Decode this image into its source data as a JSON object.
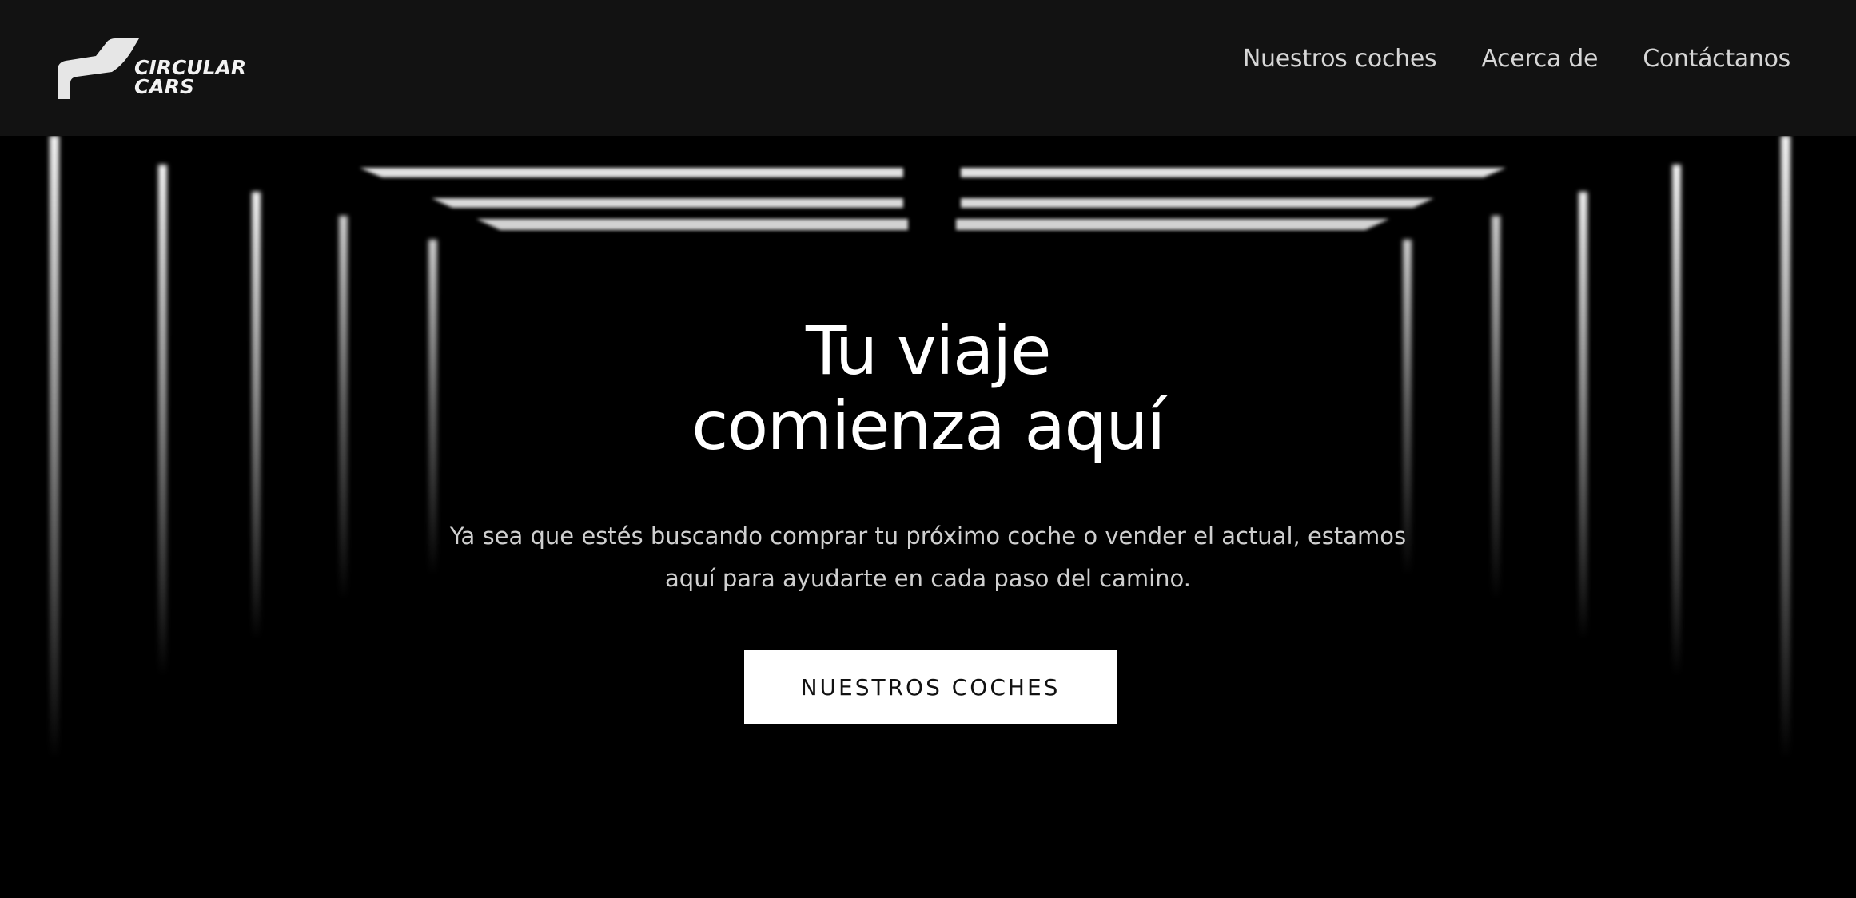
{
  "brand": {
    "line1": "CIRCULAR",
    "line2": "CARS",
    "logo_icon": "car-seat-logo-icon"
  },
  "nav": {
    "items": [
      {
        "label": "Nuestros coches"
      },
      {
        "label": "Acerca de"
      },
      {
        "label": "Contáctanos"
      }
    ]
  },
  "hero": {
    "title_line1": "Tu viaje",
    "title_line2": "comienza aquí",
    "subtitle_line1": "Ya sea que estés buscando comprar tu próximo coche o vender el actual, estamos",
    "subtitle_line2": "aquí para ayudarte en cada paso del camino.",
    "cta_label": "NUESTROS COCHES"
  },
  "colors": {
    "header_bg": "#121212",
    "page_bg": "#000000",
    "nav_text": "#d6d6d6",
    "hero_title": "#ffffff",
    "hero_subtitle": "#cfcfcf",
    "cta_bg": "#ffffff",
    "cta_text": "#111111",
    "light_strip": "#e8e8e8"
  }
}
